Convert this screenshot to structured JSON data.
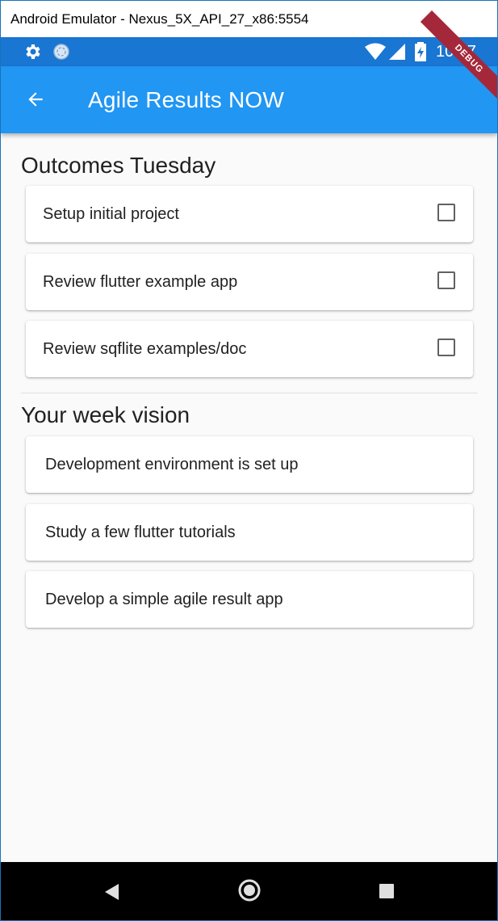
{
  "window": {
    "title": "Android Emulator - Nexus_5X_API_27_x86:5554"
  },
  "statusbar": {
    "time": "10:47"
  },
  "debug_banner": "DEBUG",
  "appbar": {
    "title": "Agile Results NOW"
  },
  "outcomes": {
    "title": "Outcomes Tuesday",
    "items": [
      {
        "label": "Setup initial project",
        "checked": false
      },
      {
        "label": "Review flutter example app",
        "checked": false
      },
      {
        "label": "Review sqflite examples/doc",
        "checked": false
      }
    ]
  },
  "vision": {
    "title": "Your week vision",
    "items": [
      {
        "label": "Development environment is set up"
      },
      {
        "label": "Study a few flutter tutorials"
      },
      {
        "label": "Develop a simple agile result app"
      }
    ]
  },
  "colors": {
    "primary": "#2196f3",
    "status_bar": "#1976d2",
    "background": "#fafafa",
    "debug_banner": "#a4283a",
    "nav_bar": "#000000"
  },
  "icons": {
    "back": "arrow-back-icon",
    "settings": "gear-icon",
    "sync": "sync-icon",
    "wifi": "wifi-icon",
    "cellular": "cellular-signal-icon",
    "battery": "battery-charging-icon",
    "nav_back": "nav-back-icon",
    "nav_home": "nav-home-icon",
    "nav_recents": "nav-recents-icon"
  }
}
